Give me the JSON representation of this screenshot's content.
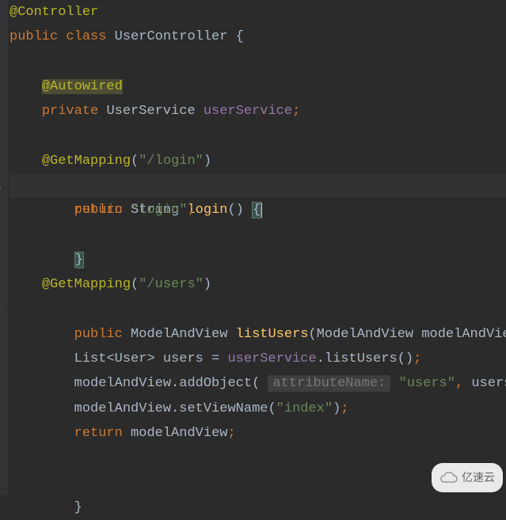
{
  "code": {
    "ann_controller": "@Controller",
    "kw_public": "public",
    "kw_class": "class",
    "class_name": "UserController",
    "ann_autowired": "@Autowired",
    "kw_private": "private",
    "type_userservice": "UserService",
    "field_userservice": "userService",
    "ann_getmapping": "@GetMapping",
    "str_login_path": "\"/login\"",
    "type_string": "String",
    "method_login": "login",
    "kw_return": "return",
    "str_login": "\"login\"",
    "str_users_path": "\"/users\"",
    "type_mav": "ModelAndView",
    "method_listusers": "listUsers",
    "param_mav": "modelAndView",
    "type_list": "List",
    "type_user": "User",
    "var_users": "users",
    "call_listusers": "listUsers",
    "call_addobject": "addObject",
    "hint_attrname": "attributeName:",
    "str_users": "\"users\"",
    "call_setviewname": "setViewName",
    "str_index": "\"index\""
  },
  "watermark": {
    "text": "亿速云"
  }
}
